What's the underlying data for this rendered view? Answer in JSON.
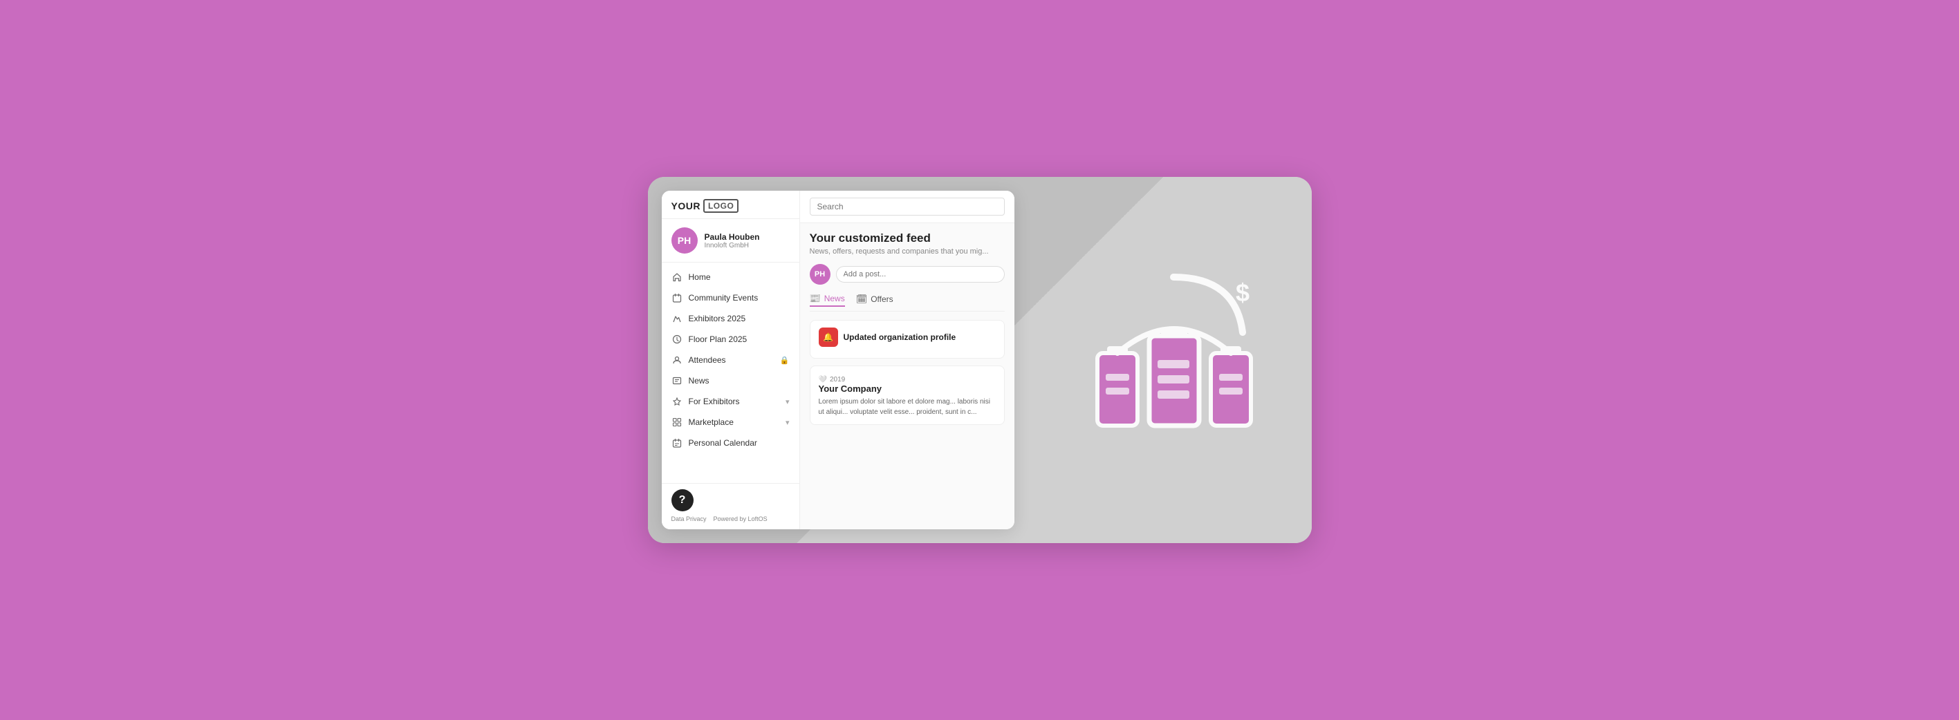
{
  "page": {
    "background_color": "#c96bbf"
  },
  "logo": {
    "your": "YOUR",
    "logo": "LOGO"
  },
  "user": {
    "name": "Paula Houben",
    "company": "Innoloft GmbH",
    "initials": "PH"
  },
  "nav": {
    "items": [
      {
        "id": "home",
        "label": "Home",
        "icon": "house",
        "chevron": false,
        "lock": false
      },
      {
        "id": "community-events",
        "label": "Community Events",
        "icon": "calendar",
        "chevron": false,
        "lock": false
      },
      {
        "id": "exhibitors-2025",
        "label": "Exhibitors 2025",
        "icon": "scissors",
        "chevron": false,
        "lock": false
      },
      {
        "id": "floor-plan-2025",
        "label": "Floor Plan 2025",
        "icon": "tag",
        "chevron": false,
        "lock": false
      },
      {
        "id": "attendees",
        "label": "Attendees",
        "icon": "person",
        "chevron": false,
        "lock": true
      },
      {
        "id": "news",
        "label": "News",
        "icon": "newspaper",
        "chevron": false,
        "lock": false
      },
      {
        "id": "for-exhibitors",
        "label": "For Exhibitors",
        "icon": "sparkle",
        "chevron": true,
        "lock": false
      },
      {
        "id": "marketplace",
        "label": "Marketplace",
        "icon": "grid",
        "chevron": true,
        "lock": false
      },
      {
        "id": "personal-calendar",
        "label": "Personal Calendar",
        "icon": "calendar2",
        "chevron": false,
        "lock": false
      }
    ]
  },
  "footer": {
    "help_label": "?",
    "data_privacy": "Data Privacy",
    "powered_by": "Powered by LoftOS"
  },
  "search": {
    "placeholder": "Search"
  },
  "feed": {
    "title": "Your customized feed",
    "subtitle": "News, offers, requests and companies that you mig...",
    "post_placeholder": "Add a post...",
    "tabs": [
      {
        "id": "news",
        "label": "News",
        "icon": "📰",
        "active": true
      },
      {
        "id": "offers",
        "label": "Offers",
        "icon": "🗓",
        "active": false
      },
      {
        "id": "other",
        "label": "",
        "icon": "",
        "active": false
      }
    ],
    "posts": [
      {
        "id": "updated-org",
        "type": "org-update",
        "icon_bg": "#e03a3a",
        "icon_char": "🔔",
        "title": "Updated organization profile",
        "meta": ""
      },
      {
        "id": "company-post",
        "type": "company",
        "year": "2019",
        "company_name": "Your Company",
        "body": "Lorem ipsum dolor sit labore et dolore mag... laboris nisi ut aliqui... voluptate velit esse... proident, sunt in c..."
      }
    ]
  }
}
